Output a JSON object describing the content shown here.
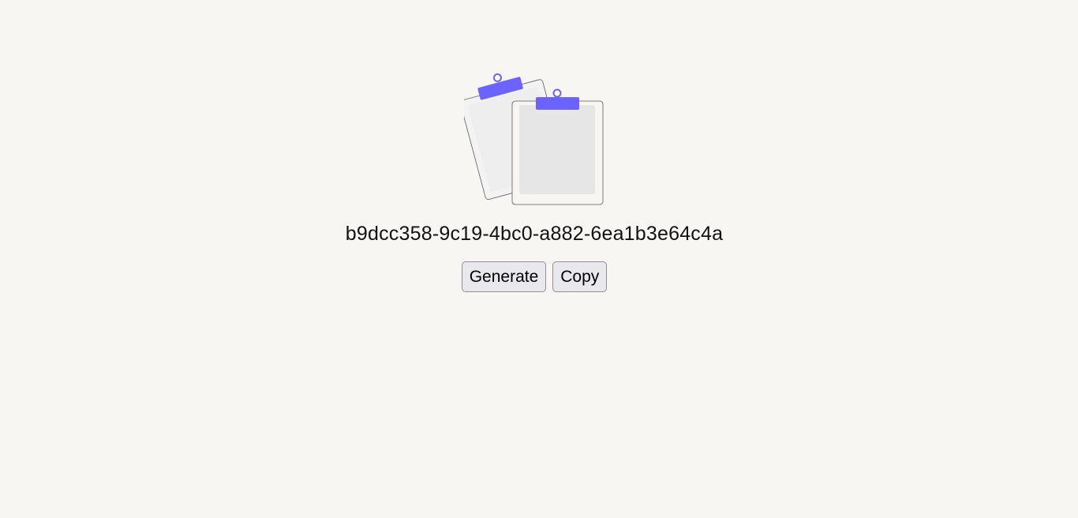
{
  "uuid_display": "b9dcc358-9c19-4bc0-a882-6ea1b3e64c4a",
  "actions": {
    "generate_label": "Generate",
    "copy_label": "Copy"
  },
  "colors": {
    "background": "#f7f6f3",
    "accent": "#6c63ff",
    "paper": "#e6e6e6",
    "button_bg": "#e9e9ed"
  },
  "illustration": {
    "icon": "clipboards-illustration"
  }
}
